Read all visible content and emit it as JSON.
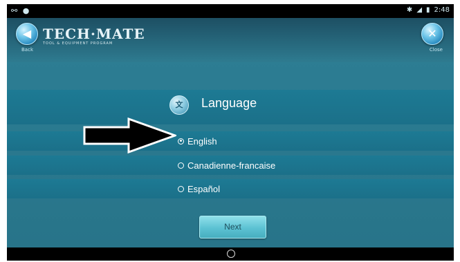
{
  "status_bar": {
    "left_icons": [
      "usb-icon",
      "location-icon"
    ],
    "right_icons": [
      "bluetooth-icon",
      "signal-icon",
      "battery-icon"
    ],
    "time": "2:48"
  },
  "header": {
    "back_label": "Back",
    "close_label": "Close",
    "logo_main": "TECH·MATE",
    "logo_sub": "TOOL & EQUIPMENT PROGRAM"
  },
  "language_screen": {
    "title": "Language",
    "title_icon": "language-icon",
    "options": [
      {
        "label": "English",
        "selected": true
      },
      {
        "label": "Canadienne-francaise",
        "selected": false
      },
      {
        "label": "Español",
        "selected": false
      }
    ],
    "next_label": "Next"
  },
  "colors": {
    "band": "#1d7a94",
    "background": "#2b7b91",
    "button": "#5cc2d3"
  }
}
